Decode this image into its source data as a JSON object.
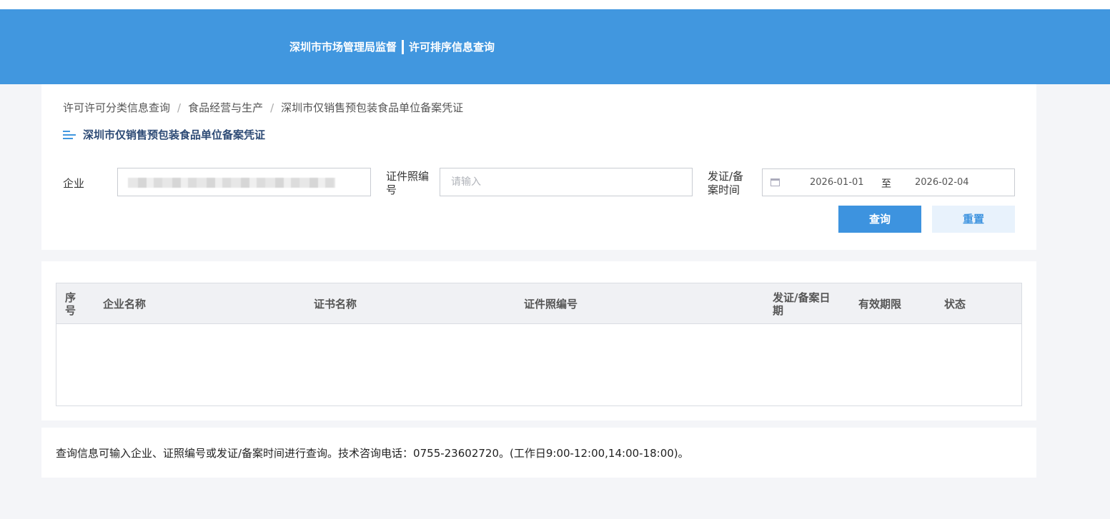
{
  "header": {
    "org_name": "深圳市市场管理局监督",
    "system_name": "许可排序信息查询"
  },
  "breadcrumb": {
    "items": [
      "许可许可分类信息查询",
      "食品经营与生产",
      "深圳市仅销售预包装食品单位备案凭证"
    ],
    "separator": "/"
  },
  "section": {
    "title": "深圳市仅销售预包装食品单位备案凭证",
    "icon": "list-icon"
  },
  "form": {
    "enterprise_label": "企业",
    "enterprise_value_blurred": true,
    "license_no_label_line1": "证件照编",
    "license_no_label_line2": "号",
    "license_no_placeholder": "请输入",
    "date_label_line1": "发证/备",
    "date_label_line2": "案时间",
    "date_start": "2026-01-01",
    "date_separator": "至",
    "date_end": "2026-02-04",
    "date_icon": "calendar-icon"
  },
  "buttons": {
    "query": "查询",
    "reset": "重置"
  },
  "table": {
    "columns": {
      "index_line1": "序",
      "index_line2": "号",
      "enterprise_name": "企业名称",
      "certificate_name": "证书名称",
      "license_no": "证件照编号",
      "date_line1": "发证/备案日",
      "date_line2": "期",
      "validity": "有效期限",
      "status": "状态"
    },
    "rows": []
  },
  "note": "查询信息可输入企业、证照编号或发证/备案时间进行查询。技术咨询电话：0755-23602720。(工作日9:00-12:00,14:00-18:00)。",
  "colors": {
    "header_bg": "#4197df",
    "primary_button": "#3d93df",
    "secondary_button_bg": "#e8f2fc",
    "page_bg": "#f4f5f8"
  }
}
